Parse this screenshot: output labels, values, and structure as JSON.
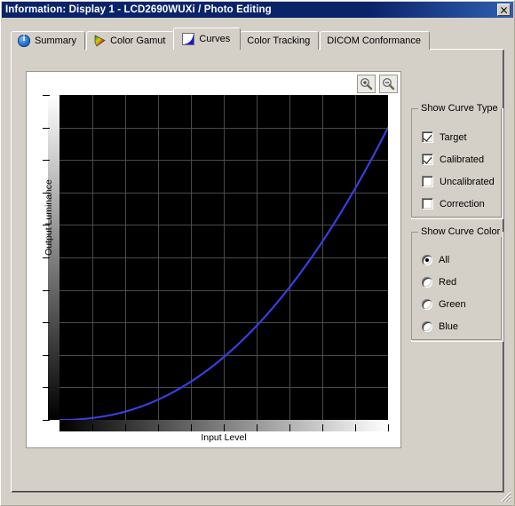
{
  "window": {
    "title": "Information: Display 1 - LCD2690WUXi / Photo Editing",
    "close_label": "x"
  },
  "tabs": [
    {
      "label": "Summary",
      "icon": "info-icon",
      "selected": false
    },
    {
      "label": "Color Gamut",
      "icon": "gamut-icon",
      "selected": false
    },
    {
      "label": "Curves",
      "icon": "curves-icon",
      "selected": true
    },
    {
      "label": "Color Tracking",
      "icon": "tracking-icon",
      "selected": false
    },
    {
      "label": "DICOM Conformance",
      "icon": "dicom-icon",
      "selected": false
    }
  ],
  "chart_toolbar": {
    "zoom_in_label": "zoom-in-icon",
    "zoom_out_label": "zoom-out-icon"
  },
  "curve_type": {
    "title": "Show Curve Type",
    "options": [
      {
        "label": "Target",
        "checked": true
      },
      {
        "label": "Calibrated",
        "checked": true
      },
      {
        "label": "Uncalibrated",
        "checked": false
      },
      {
        "label": "Correction",
        "checked": false
      }
    ]
  },
  "curve_color": {
    "title": "Show Curve Color",
    "options": [
      {
        "label": "All",
        "checked": true
      },
      {
        "label": "Red",
        "checked": false
      },
      {
        "label": "Green",
        "checked": false
      },
      {
        "label": "Blue",
        "checked": false
      }
    ]
  },
  "chart_data": {
    "type": "line",
    "title": "",
    "xlabel": "Input Level",
    "ylabel": "Output Luminance",
    "xlim": [
      0,
      100
    ],
    "ylim": [
      0,
      100
    ],
    "grid": true,
    "x_divisions": 10,
    "y_divisions": 10,
    "grid_color": "#4a4a4a",
    "plot_background": "#000000",
    "legend": "none",
    "x_gradient": [
      "#000000",
      "#ffffff"
    ],
    "y_gradient": [
      "#ffffff",
      "#000000"
    ],
    "series": [
      {
        "name": "Target",
        "color": "#2a2ad0",
        "x": [
          0,
          5,
          10,
          15,
          20,
          25,
          30,
          35,
          40,
          45,
          50,
          55,
          60,
          65,
          70,
          75,
          80,
          85,
          90,
          95,
          100
        ],
        "y": [
          0.0,
          0.12,
          0.55,
          1.33,
          2.51,
          4.12,
          6.17,
          8.7,
          11.71,
          15.22,
          19.25,
          23.8,
          28.89,
          34.52,
          40.7,
          47.45,
          54.76,
          62.66,
          71.13,
          80.19,
          89.85
        ]
      },
      {
        "name": "Calibrated",
        "color": "#3c46dc",
        "x": [
          0,
          5,
          10,
          15,
          20,
          25,
          30,
          35,
          40,
          45,
          50,
          55,
          60,
          65,
          70,
          75,
          80,
          85,
          90,
          95,
          100
        ],
        "y": [
          0.0,
          0.15,
          0.6,
          1.4,
          2.6,
          4.22,
          6.28,
          8.82,
          11.84,
          15.36,
          19.4,
          23.96,
          29.06,
          34.7,
          40.89,
          47.65,
          54.97,
          62.88,
          71.36,
          80.43,
          90.1
        ]
      }
    ]
  }
}
